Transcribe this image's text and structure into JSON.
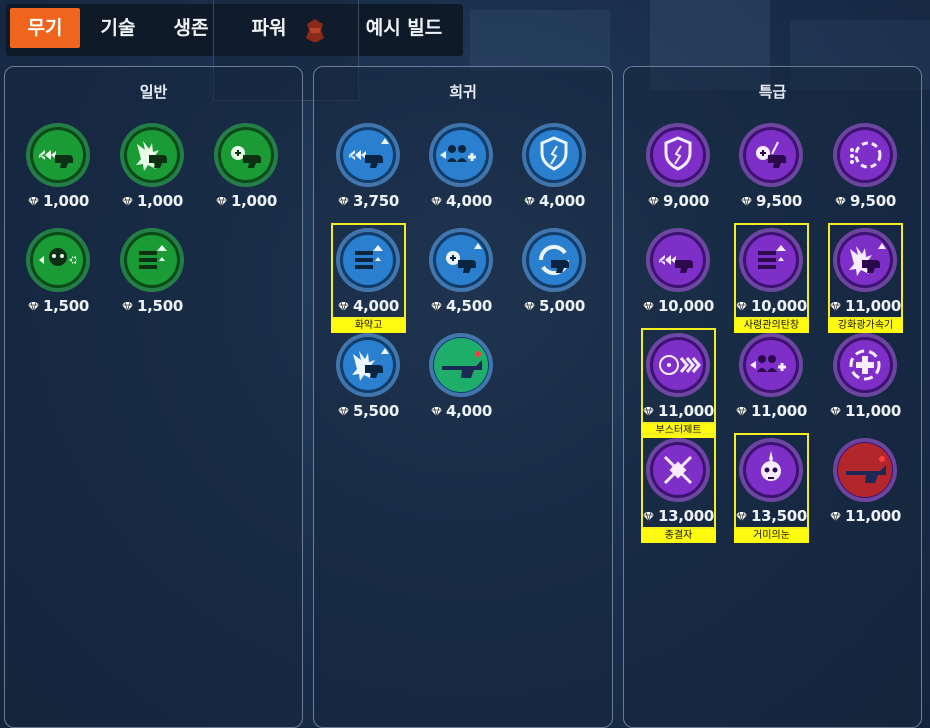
{
  "tabs": [
    {
      "label": "무기",
      "active": true
    },
    {
      "label": "기술",
      "active": false
    },
    {
      "label": "생존",
      "active": false
    },
    {
      "label": "파워",
      "active": false
    },
    {
      "label": "예시 빌드",
      "active": false
    }
  ],
  "panels": {
    "common": {
      "title": "일반",
      "color": "#1fae3c"
    },
    "rare": {
      "title": "희귀",
      "color": "#2a86d6"
    },
    "epic": {
      "title": "특급",
      "color": "#8c2fd9"
    }
  },
  "items": {
    "common": [
      {
        "icon": "triple-arrow-gun-icon",
        "price": "1,000"
      },
      {
        "icon": "blast-gun-icon",
        "price": "1,000"
      },
      {
        "icon": "heal-gun-icon",
        "price": "1,000"
      },
      {
        "icon": "skull-arrows-icon",
        "price": "1,500"
      },
      {
        "icon": "ammo-up-icon",
        "price": "1,500"
      }
    ],
    "rare": [
      {
        "icon": "triple-arrow-gun-up-icon",
        "price": "3,750"
      },
      {
        "icon": "team-heal-icon",
        "price": "4,000"
      },
      {
        "icon": "shield-break-icon",
        "price": "4,000"
      },
      {
        "icon": "ammo-up-icon",
        "price": "4,000",
        "label": "화약고"
      },
      {
        "icon": "heal-gun-up-icon",
        "price": "4,500"
      },
      {
        "icon": "reload-cycle-icon",
        "price": "5,000"
      },
      {
        "icon": "blast-gun-up-icon",
        "price": "5,500"
      },
      {
        "icon": "hero-weapon-icon",
        "price": "4,000"
      }
    ],
    "epic": [
      {
        "icon": "shield-slash-icon",
        "price": "9,000"
      },
      {
        "icon": "heal-gun-slash-icon",
        "price": "9,500"
      },
      {
        "icon": "swirl-dots-icon",
        "price": "9,500"
      },
      {
        "icon": "triple-arrow-gun-icon",
        "price": "10,000"
      },
      {
        "icon": "ammo-up-icon",
        "price": "10,000",
        "label": "사령관의탄창"
      },
      {
        "icon": "blast-gun-up-icon",
        "price": "11,000",
        "label": "강화광가속기"
      },
      {
        "icon": "node-arrows-icon",
        "price": "11,000",
        "label": "부스터제트"
      },
      {
        "icon": "team-heal-plus-icon",
        "price": "11,000"
      },
      {
        "icon": "crosshair-plus-icon",
        "price": "11,000"
      },
      {
        "icon": "x-burst-icon",
        "price": "13,000",
        "label": "종결자"
      },
      {
        "icon": "spider-skull-icon",
        "price": "13,500",
        "label": "거미의눈"
      },
      {
        "icon": "hero-weapon-red-icon",
        "price": "11,000"
      }
    ]
  }
}
